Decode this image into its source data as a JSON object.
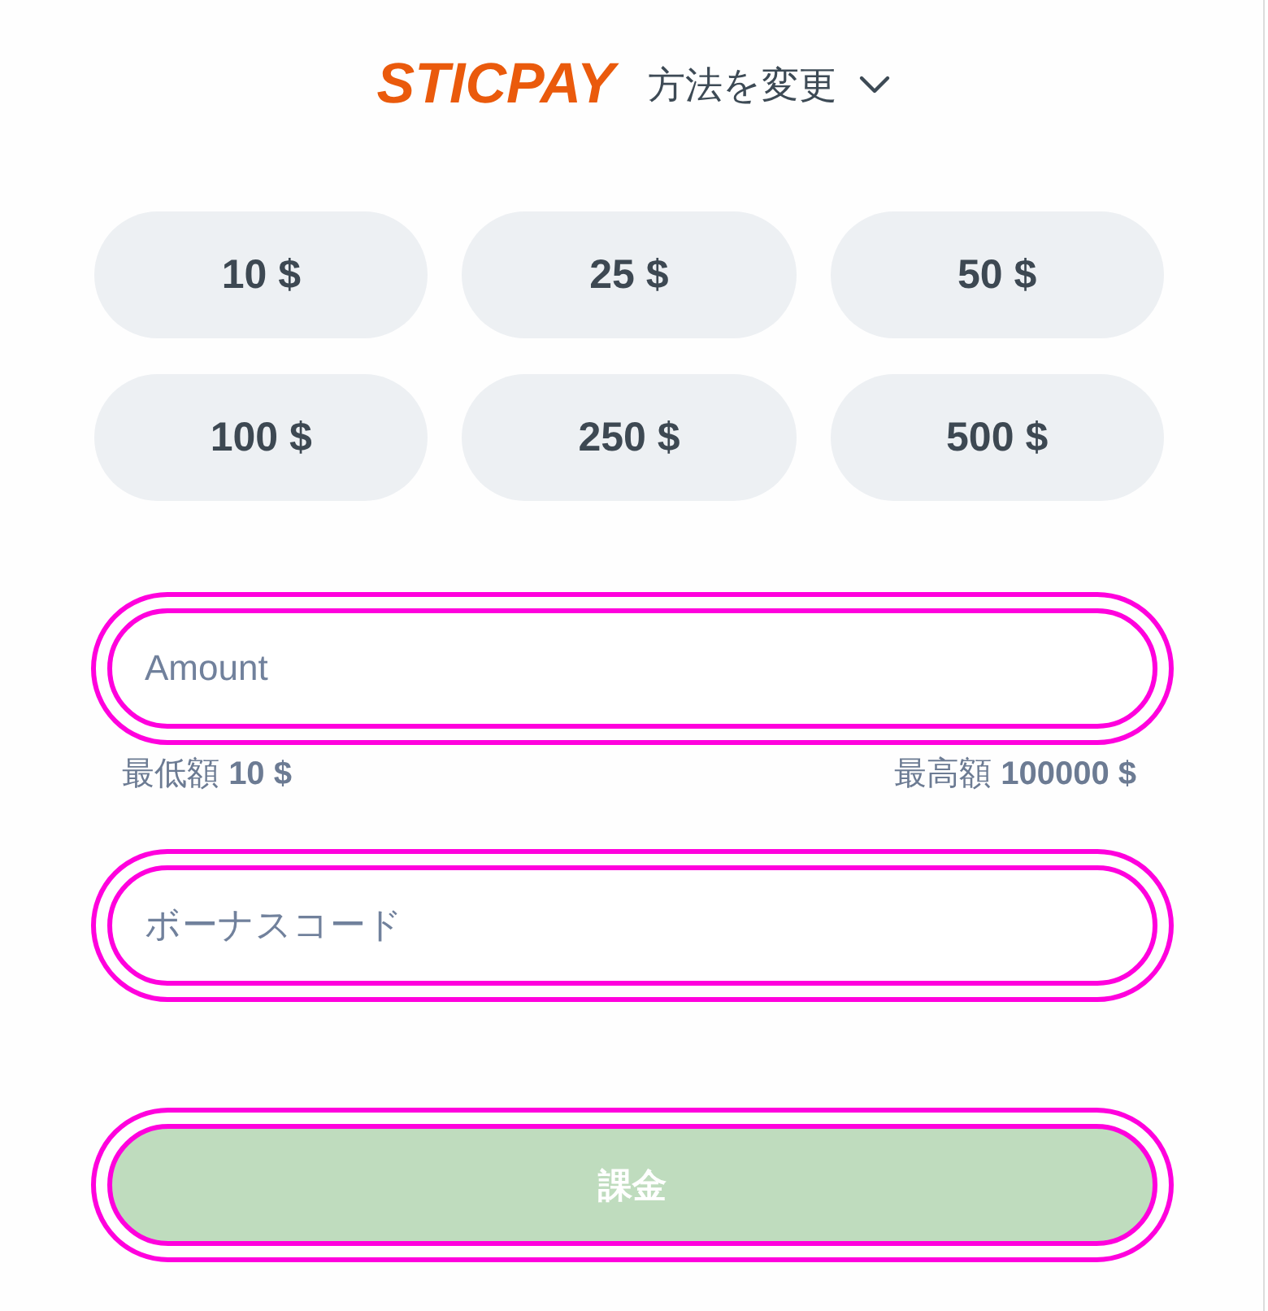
{
  "header": {
    "logo": "STICPAY",
    "change_method": "方法を変更"
  },
  "presets": [
    {
      "label": "10 $",
      "selected": false
    },
    {
      "label": "25 $",
      "selected": false
    },
    {
      "label": "50 $",
      "selected": false
    },
    {
      "label": "100 $",
      "selected": false
    },
    {
      "label": "250 $",
      "selected": false
    },
    {
      "label": "500 $",
      "selected": false
    }
  ],
  "amount": {
    "placeholder": "Amount",
    "highlighted": true
  },
  "limits": {
    "min": "最低額 **10 $**",
    "max": "最高額 **100000 $**"
  },
  "bonus": {
    "placeholder": "ボーナスコード",
    "highlighted": true
  },
  "submit": {
    "label": "課金",
    "disabled": true,
    "highlighted": true
  }
}
